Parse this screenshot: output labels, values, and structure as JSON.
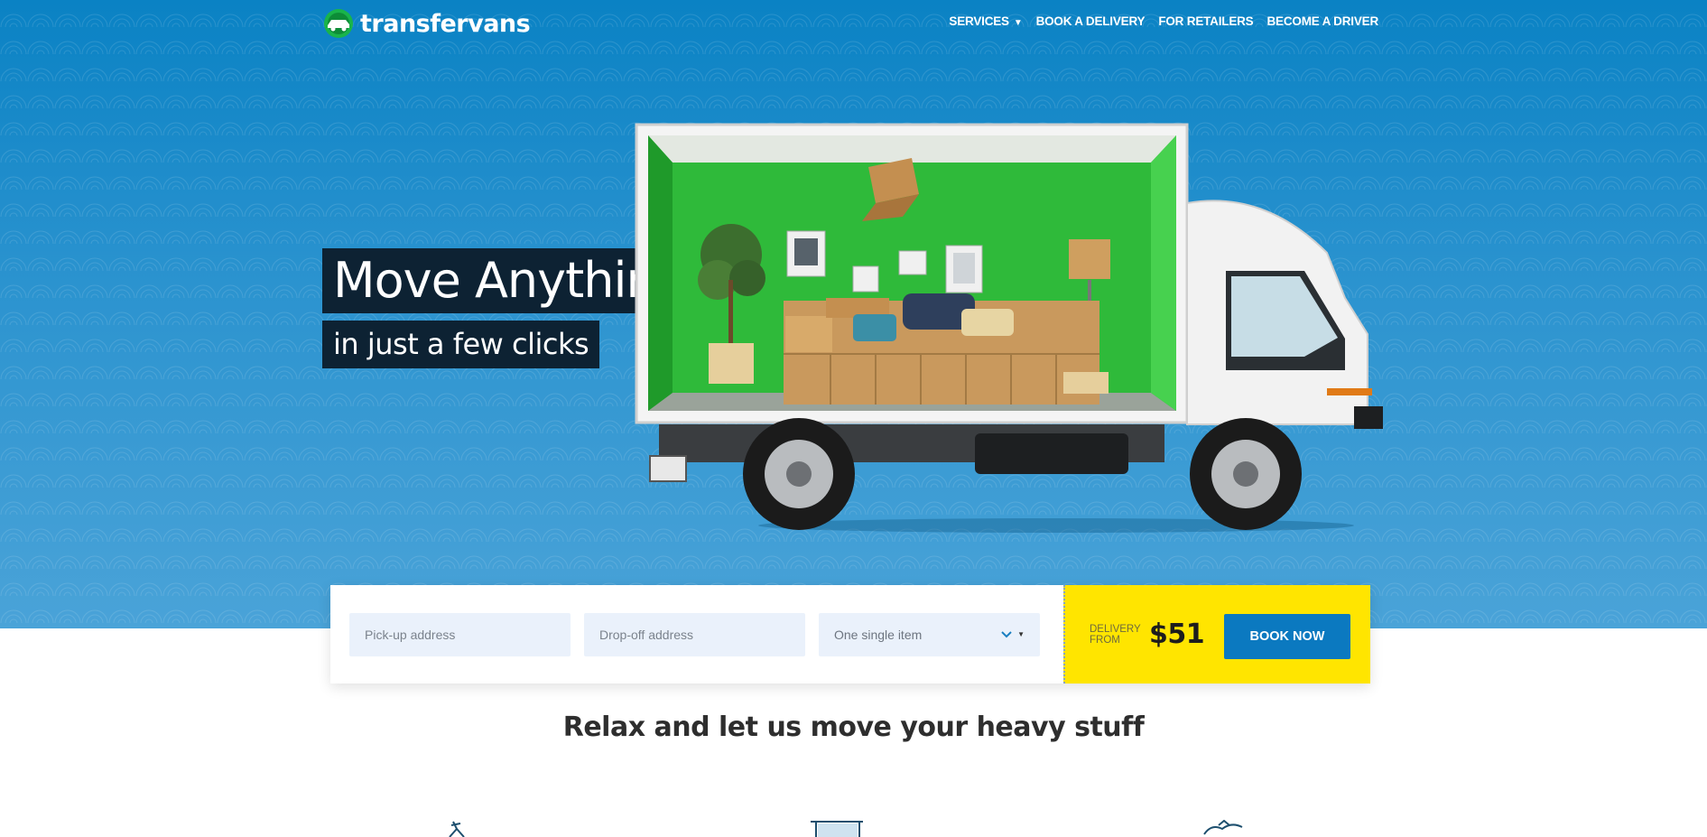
{
  "header": {
    "logo_text": "transfervans",
    "nav": [
      {
        "label": "SERVICES",
        "has_dropdown": true
      },
      {
        "label": "BOOK A DELIVERY"
      },
      {
        "label": "FOR RETAILERS"
      },
      {
        "label": "BECOME A DRIVER"
      }
    ],
    "dropdown_caret": "▼"
  },
  "hero": {
    "headline": "Move Anything",
    "subheadline": "in just a few clicks"
  },
  "booking": {
    "pickup_placeholder": "Pick-up address",
    "dropoff_placeholder": "Drop-off address",
    "item_select_value": "One single item",
    "delivery_label_line1": "DELIVERY",
    "delivery_label_line2": "FROM",
    "price": "$51",
    "book_button": "BOOK NOW"
  },
  "section": {
    "tagline": "Relax and let us move your heavy stuff"
  },
  "colors": {
    "hero_blue": "#0a82c4",
    "cta_yellow": "#ffe500",
    "button_blue": "#0b79c0",
    "headline_bg": "#0d2233",
    "field_bg": "#eaf1fb"
  },
  "icons": [
    "logo-van-icon",
    "chevron-down-icon",
    "feature-icon-1",
    "feature-icon-2",
    "feature-icon-3"
  ]
}
